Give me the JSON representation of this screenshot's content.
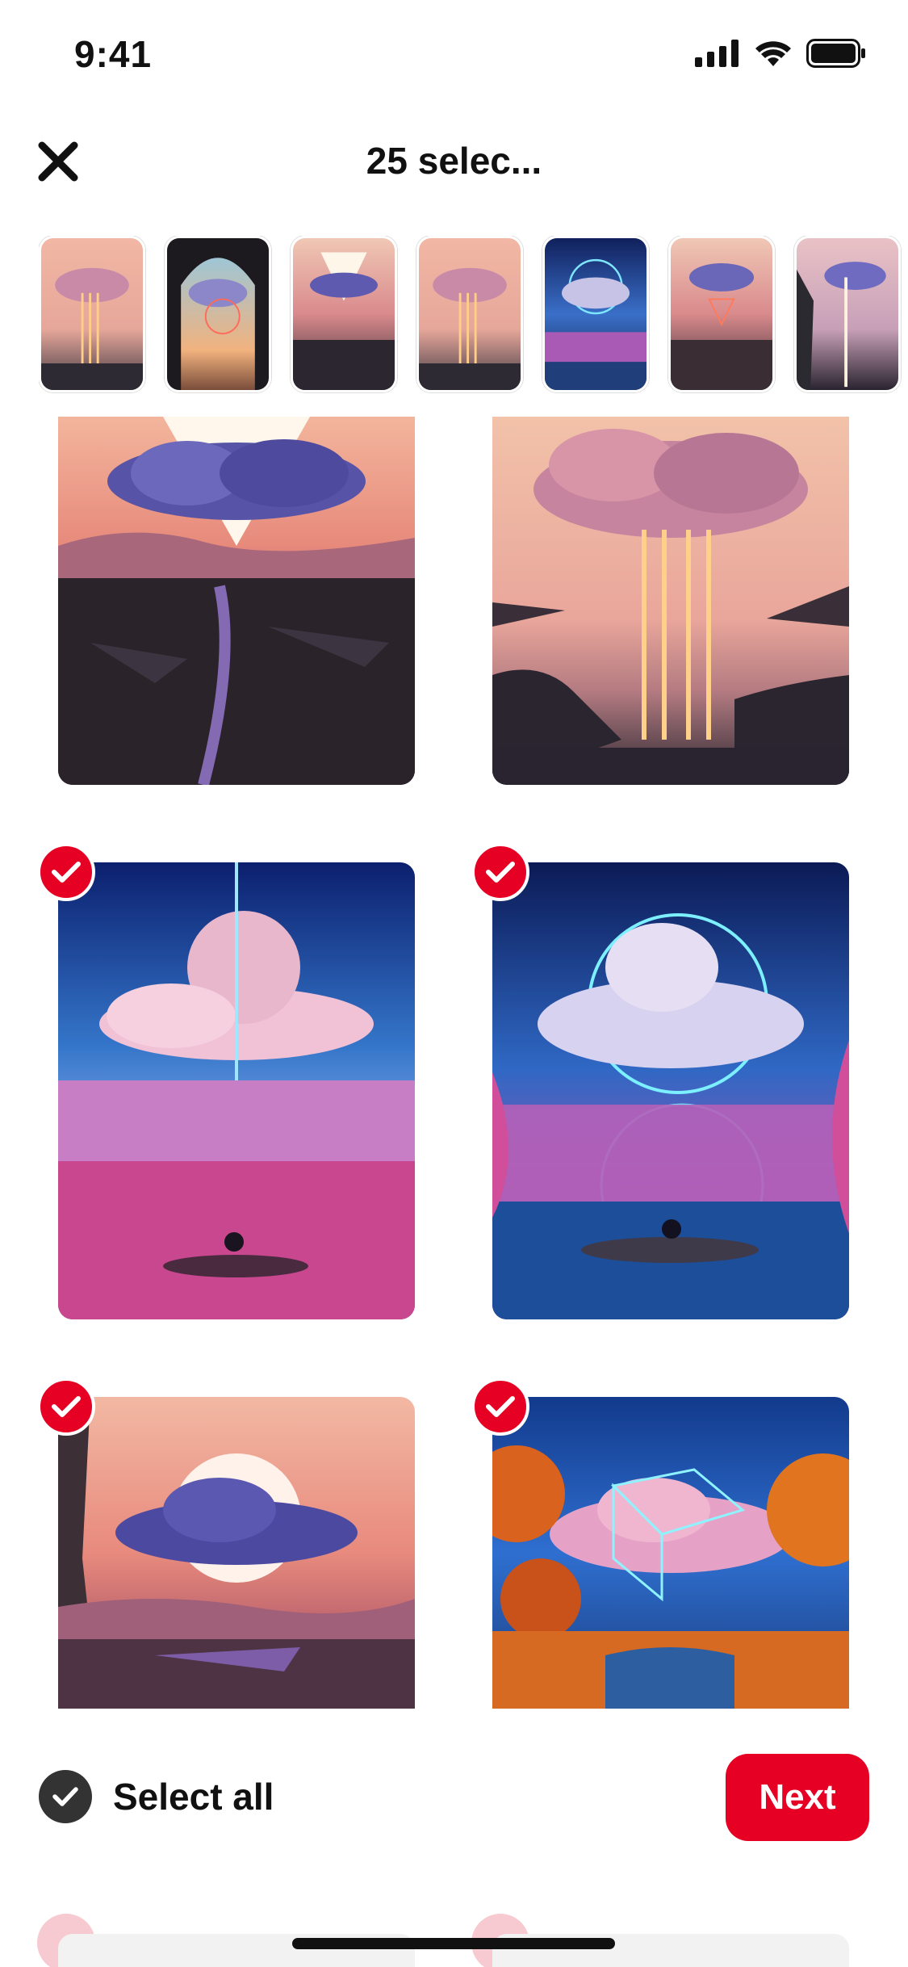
{
  "status_bar": {
    "time": "9:41"
  },
  "header": {
    "title": "25 selec..."
  },
  "thumbnails": [
    {
      "name": "thumb-cloud-beams"
    },
    {
      "name": "thumb-cave-cloud-ring"
    },
    {
      "name": "thumb-triangle-cloud"
    },
    {
      "name": "thumb-cloud-beams-2"
    },
    {
      "name": "thumb-neon-cloud-lake"
    },
    {
      "name": "thumb-triangle-sunset"
    },
    {
      "name": "thumb-cloud-cliff"
    }
  ],
  "grid": {
    "cards": [
      {
        "name": "card-triangle-cloud",
        "selected": false
      },
      {
        "name": "card-cloud-light-beams",
        "selected": false
      },
      {
        "name": "card-pink-meadow-beam",
        "selected": true
      },
      {
        "name": "card-neon-circle-lake",
        "selected": true
      },
      {
        "name": "card-moon-cloud-canyon",
        "selected": true
      },
      {
        "name": "card-autumn-cube-cloud",
        "selected": true
      }
    ]
  },
  "footer": {
    "select_all_label": "Select all",
    "next_label": "Next"
  },
  "colors": {
    "accent": "#e60023",
    "check_dark": "#333333"
  }
}
